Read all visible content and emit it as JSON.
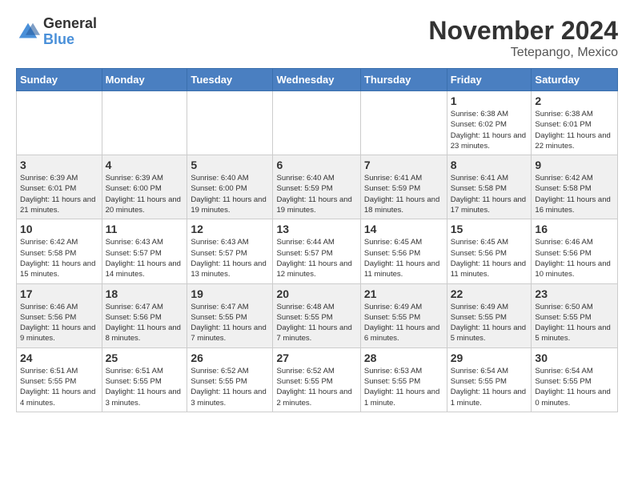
{
  "header": {
    "logo_general": "General",
    "logo_blue": "Blue",
    "month_title": "November 2024",
    "location": "Tetepango, Mexico"
  },
  "days_of_week": [
    "Sunday",
    "Monday",
    "Tuesday",
    "Wednesday",
    "Thursday",
    "Friday",
    "Saturday"
  ],
  "weeks": [
    [
      {
        "day": "",
        "info": ""
      },
      {
        "day": "",
        "info": ""
      },
      {
        "day": "",
        "info": ""
      },
      {
        "day": "",
        "info": ""
      },
      {
        "day": "",
        "info": ""
      },
      {
        "day": "1",
        "info": "Sunrise: 6:38 AM\nSunset: 6:02 PM\nDaylight: 11 hours and 23 minutes."
      },
      {
        "day": "2",
        "info": "Sunrise: 6:38 AM\nSunset: 6:01 PM\nDaylight: 11 hours and 22 minutes."
      }
    ],
    [
      {
        "day": "3",
        "info": "Sunrise: 6:39 AM\nSunset: 6:01 PM\nDaylight: 11 hours and 21 minutes."
      },
      {
        "day": "4",
        "info": "Sunrise: 6:39 AM\nSunset: 6:00 PM\nDaylight: 11 hours and 20 minutes."
      },
      {
        "day": "5",
        "info": "Sunrise: 6:40 AM\nSunset: 6:00 PM\nDaylight: 11 hours and 19 minutes."
      },
      {
        "day": "6",
        "info": "Sunrise: 6:40 AM\nSunset: 5:59 PM\nDaylight: 11 hours and 19 minutes."
      },
      {
        "day": "7",
        "info": "Sunrise: 6:41 AM\nSunset: 5:59 PM\nDaylight: 11 hours and 18 minutes."
      },
      {
        "day": "8",
        "info": "Sunrise: 6:41 AM\nSunset: 5:58 PM\nDaylight: 11 hours and 17 minutes."
      },
      {
        "day": "9",
        "info": "Sunrise: 6:42 AM\nSunset: 5:58 PM\nDaylight: 11 hours and 16 minutes."
      }
    ],
    [
      {
        "day": "10",
        "info": "Sunrise: 6:42 AM\nSunset: 5:58 PM\nDaylight: 11 hours and 15 minutes."
      },
      {
        "day": "11",
        "info": "Sunrise: 6:43 AM\nSunset: 5:57 PM\nDaylight: 11 hours and 14 minutes."
      },
      {
        "day": "12",
        "info": "Sunrise: 6:43 AM\nSunset: 5:57 PM\nDaylight: 11 hours and 13 minutes."
      },
      {
        "day": "13",
        "info": "Sunrise: 6:44 AM\nSunset: 5:57 PM\nDaylight: 11 hours and 12 minutes."
      },
      {
        "day": "14",
        "info": "Sunrise: 6:45 AM\nSunset: 5:56 PM\nDaylight: 11 hours and 11 minutes."
      },
      {
        "day": "15",
        "info": "Sunrise: 6:45 AM\nSunset: 5:56 PM\nDaylight: 11 hours and 11 minutes."
      },
      {
        "day": "16",
        "info": "Sunrise: 6:46 AM\nSunset: 5:56 PM\nDaylight: 11 hours and 10 minutes."
      }
    ],
    [
      {
        "day": "17",
        "info": "Sunrise: 6:46 AM\nSunset: 5:56 PM\nDaylight: 11 hours and 9 minutes."
      },
      {
        "day": "18",
        "info": "Sunrise: 6:47 AM\nSunset: 5:56 PM\nDaylight: 11 hours and 8 minutes."
      },
      {
        "day": "19",
        "info": "Sunrise: 6:47 AM\nSunset: 5:55 PM\nDaylight: 11 hours and 7 minutes."
      },
      {
        "day": "20",
        "info": "Sunrise: 6:48 AM\nSunset: 5:55 PM\nDaylight: 11 hours and 7 minutes."
      },
      {
        "day": "21",
        "info": "Sunrise: 6:49 AM\nSunset: 5:55 PM\nDaylight: 11 hours and 6 minutes."
      },
      {
        "day": "22",
        "info": "Sunrise: 6:49 AM\nSunset: 5:55 PM\nDaylight: 11 hours and 5 minutes."
      },
      {
        "day": "23",
        "info": "Sunrise: 6:50 AM\nSunset: 5:55 PM\nDaylight: 11 hours and 5 minutes."
      }
    ],
    [
      {
        "day": "24",
        "info": "Sunrise: 6:51 AM\nSunset: 5:55 PM\nDaylight: 11 hours and 4 minutes."
      },
      {
        "day": "25",
        "info": "Sunrise: 6:51 AM\nSunset: 5:55 PM\nDaylight: 11 hours and 3 minutes."
      },
      {
        "day": "26",
        "info": "Sunrise: 6:52 AM\nSunset: 5:55 PM\nDaylight: 11 hours and 3 minutes."
      },
      {
        "day": "27",
        "info": "Sunrise: 6:52 AM\nSunset: 5:55 PM\nDaylight: 11 hours and 2 minutes."
      },
      {
        "day": "28",
        "info": "Sunrise: 6:53 AM\nSunset: 5:55 PM\nDaylight: 11 hours and 1 minute."
      },
      {
        "day": "29",
        "info": "Sunrise: 6:54 AM\nSunset: 5:55 PM\nDaylight: 11 hours and 1 minute."
      },
      {
        "day": "30",
        "info": "Sunrise: 6:54 AM\nSunset: 5:55 PM\nDaylight: 11 hours and 0 minutes."
      }
    ]
  ]
}
